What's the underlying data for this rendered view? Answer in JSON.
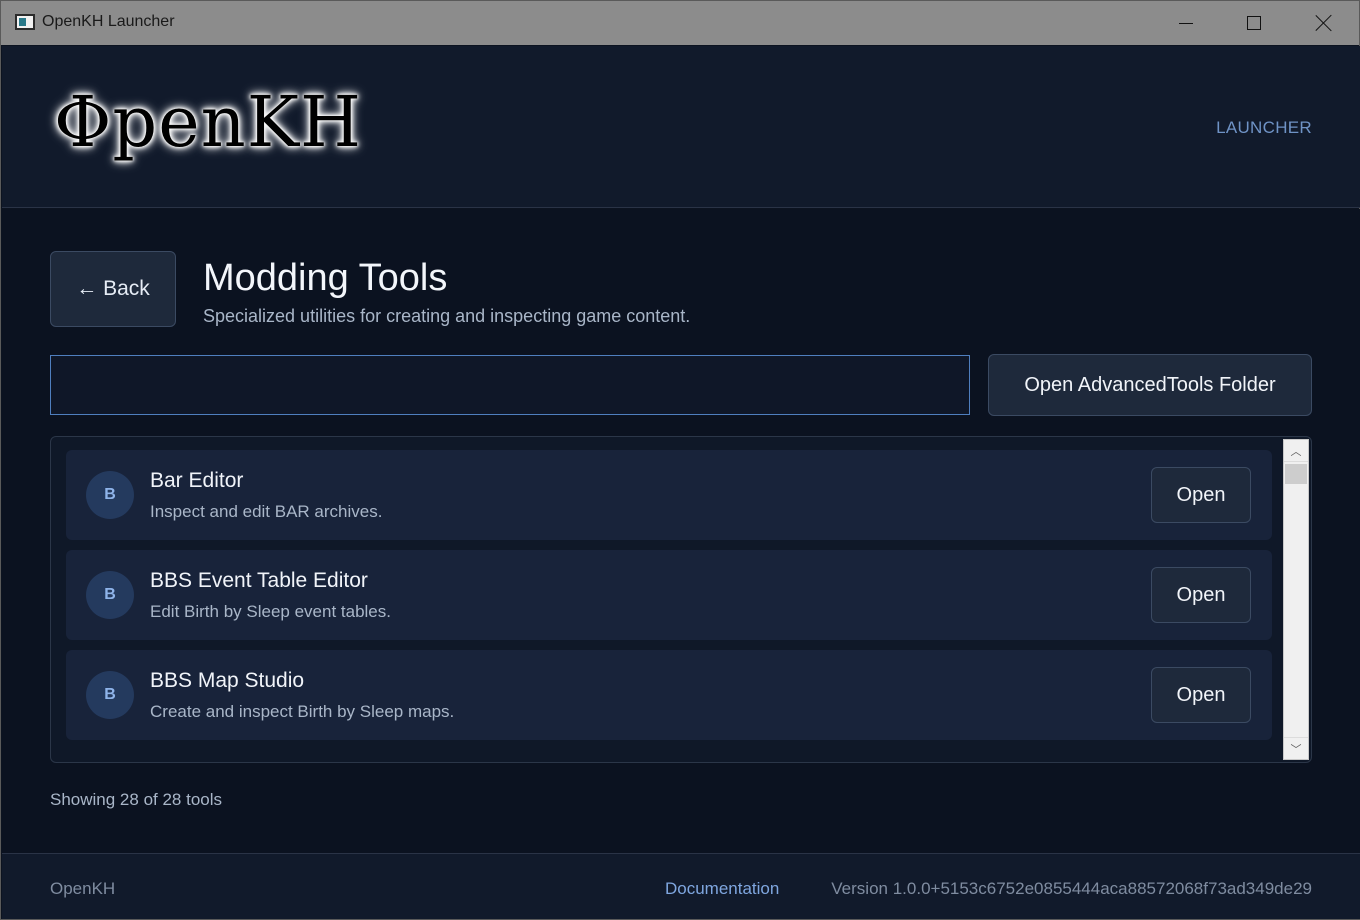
{
  "window": {
    "title": "OpenKH Launcher",
    "icon": "app-window-icon"
  },
  "header": {
    "logo_text": "ΦpenKH",
    "nav_label": "LAUNCHER"
  },
  "page": {
    "back_label": "← Back",
    "title": "Modding Tools",
    "subtitle": "Specialized utilities for creating and inspecting game content."
  },
  "search": {
    "value": "",
    "placeholder": ""
  },
  "toolbar": {
    "open_folder_label": "Open AdvancedTools Folder"
  },
  "tools": [
    {
      "initial": "B",
      "name": "Bar Editor",
      "description": "Inspect and edit BAR archives.",
      "action": "Open"
    },
    {
      "initial": "B",
      "name": "BBS Event Table Editor",
      "description": "Edit Birth by Sleep event tables.",
      "action": "Open"
    },
    {
      "initial": "B",
      "name": "BBS Map Studio",
      "description": "Create and inspect Birth by Sleep maps.",
      "action": "Open"
    }
  ],
  "scrollbar": {
    "up_glyph": "︿",
    "down_glyph": "﹀"
  },
  "status": {
    "count_text": "Showing 28 of 28 tools"
  },
  "footer": {
    "brand": "OpenKH",
    "docs_link": "Documentation",
    "version": "Version 1.0.0+5153c6752e0855444aca88572068f73ad349de29"
  },
  "colors": {
    "background": "#0b1220",
    "header": "#111a2b",
    "card": "#18233a",
    "button": "#1e293b",
    "accent": "#6f93c6",
    "input_border": "#4f7fbf"
  }
}
